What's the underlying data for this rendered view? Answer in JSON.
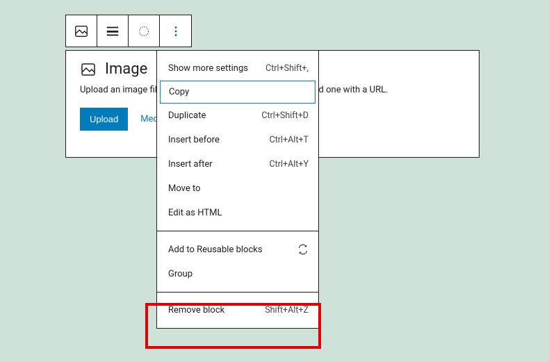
{
  "toolbar": {
    "items": [
      {
        "name": "image-type-icon"
      },
      {
        "name": "align-icon"
      },
      {
        "name": "crop-icon"
      },
      {
        "name": "more-options-icon"
      }
    ]
  },
  "block": {
    "title": "Image",
    "description": "Upload an image file, pick one from your media library, or add one with a URL.",
    "upload_label": "Upload",
    "media_library_label": "Media Library"
  },
  "menu": {
    "groups": [
      [
        {
          "label": "Show more settings",
          "shortcut": "Ctrl+Shift+,"
        },
        {
          "label": "Copy",
          "shortcut": "",
          "highlight": true
        },
        {
          "label": "Duplicate",
          "shortcut": "Ctrl+Shift+D"
        },
        {
          "label": "Insert before",
          "shortcut": "Ctrl+Alt+T"
        },
        {
          "label": "Insert after",
          "shortcut": "Ctrl+Alt+Y"
        },
        {
          "label": "Move to",
          "shortcut": ""
        },
        {
          "label": "Edit as HTML",
          "shortcut": ""
        }
      ],
      [
        {
          "label": "Add to Reusable blocks",
          "shortcut": "",
          "trailing_icon": "reusable-icon"
        },
        {
          "label": "Group",
          "shortcut": ""
        }
      ],
      [
        {
          "label": "Remove block",
          "shortcut": "Shift+Alt+Z"
        }
      ]
    ]
  }
}
